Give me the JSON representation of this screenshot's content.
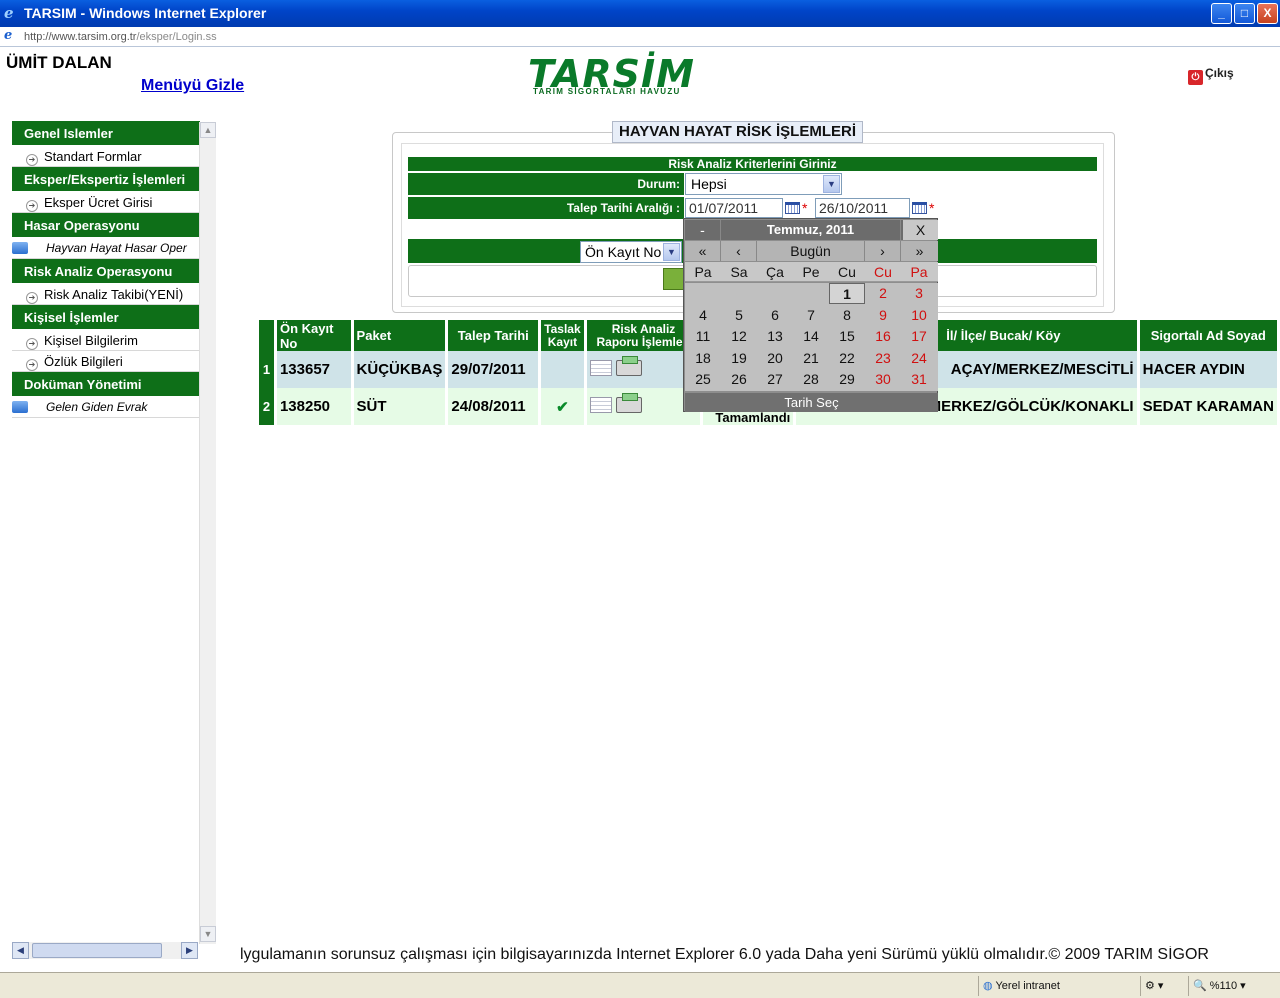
{
  "window": {
    "title": "TARSIM - Windows Internet Explorer",
    "min": "_",
    "max": "□",
    "close": "X"
  },
  "address": {
    "host": "http://www.tarsim.org.tr",
    "path": "/eksper/Login.ss"
  },
  "header": {
    "user_name": "ÜMİT DALAN",
    "hide_menu": "Menüyü Gizle",
    "logo_main": "TARSİM",
    "logo_sub": "TARIM SİGORTALARI HAVUZU",
    "logout": "Çıkış"
  },
  "sidebar": {
    "groups": [
      {
        "title": "Genel Islemler",
        "items": [
          "Standart Formlar"
        ]
      },
      {
        "title": "Eksper/Ekspertiz İşlemleri",
        "items": [
          "Eksper Ücret Girisi"
        ]
      },
      {
        "title": "Hasar Operasyonu",
        "items": [
          "Hayvan Hayat Hasar Oper"
        ]
      },
      {
        "title": "Risk Analiz Operasyonu",
        "items": [
          "Risk Analiz Takibi(YENİ)"
        ]
      },
      {
        "title": "Kişisel İşlemler",
        "items": [
          "Kişisel Bilgilerim",
          "Özlük Bilgileri"
        ]
      },
      {
        "title": "Doküman Yönetimi",
        "items": [
          "Gelen Giden Evrak"
        ]
      }
    ]
  },
  "page": {
    "title": "HAYVAN HAYAT RİSK İŞLEMLERİ"
  },
  "criteria": {
    "heading": "Risk Analiz Kriterlerini Giriniz",
    "durum_label": "Durum:",
    "durum_value": "Hepsi",
    "date_label": "Talep Tarihi Aralığı :",
    "date_from": "01/07/2011",
    "date_to": "26/10/2011",
    "required": "*",
    "sort_value": "Ön Kayıt No"
  },
  "table": {
    "headers": [
      "Ön Kayıt No",
      "Paket",
      "Talep Tarihi",
      "Taslak Kayıt",
      "Risk Analiz Raporu İşlemleri",
      "İl/ İlçe/ Bucak/ Köy",
      "Sigortalı Ad Soyad"
    ],
    "rows": [
      {
        "no": "1",
        "on_kayit": "133657",
        "paket": "KÜÇÜKBAŞ",
        "tarih": "29/07/2011",
        "taslak": "",
        "yer": "AÇAY/MERKEZ/MESCİTLİ",
        "ad": "HACER AYDIN",
        "status": ""
      },
      {
        "no": "2",
        "on_kayit": "138250",
        "paket": "SÜT",
        "tarih": "24/08/2011",
        "taslak": "✔",
        "yer": "/ MERKEZ/GÖLCÜK/KONAKLI",
        "ad": "SEDAT KARAMAN",
        "status": "Tamamlandı"
      }
    ]
  },
  "calendar": {
    "title": "Temmuz, 2011",
    "nav": {
      "minus": "-",
      "close": "X",
      "prev_year": "«",
      "prev": "‹",
      "today": "Bugün",
      "next": "›",
      "next_year": "»"
    },
    "dow": [
      "Pa",
      "Sa",
      "Ça",
      "Pe",
      "Cu",
      "Cu",
      "Pa"
    ],
    "weeks": [
      [
        "",
        "",
        "",
        "",
        "1",
        "2",
        "3"
      ],
      [
        "4",
        "5",
        "6",
        "7",
        "8",
        "9",
        "10"
      ],
      [
        "11",
        "12",
        "13",
        "14",
        "15",
        "16",
        "17"
      ],
      [
        "18",
        "19",
        "20",
        "21",
        "22",
        "23",
        "24"
      ],
      [
        "25",
        "26",
        "27",
        "28",
        "29",
        "30",
        "31"
      ]
    ],
    "selected": "1",
    "footer": "Tarih Seç"
  },
  "footer": {
    "text": "lygulamanın sorunsuz çalışması için bilgisayarınızda Internet Explorer 6.0 yada Daha yeni Sürümü yüklü olmalıdır.© 2009 TARIM SİGOR"
  },
  "status": {
    "zone": "Yerel intranet",
    "zoom": "%110"
  },
  "colors": {
    "green": "#0e6f18",
    "accent": "#0044c8"
  }
}
